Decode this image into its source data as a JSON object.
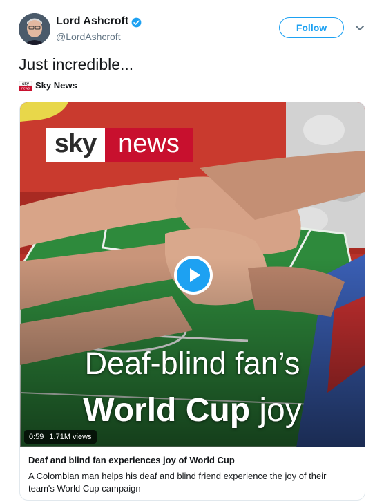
{
  "author": {
    "name": "Lord Ashcroft",
    "handle": "@LordAshcroft"
  },
  "follow_button": {
    "label": "Follow"
  },
  "tweet": {
    "text": "Just incredible..."
  },
  "source": {
    "name": "Sky News"
  },
  "media": {
    "logo": {
      "part1": "sky",
      "part2": "news"
    },
    "headline_line1": "Deaf-blind fan’s",
    "headline_line2_bold": "World Cup",
    "headline_line2_light": "joy",
    "duration": "0:59",
    "views": "1.71M views"
  },
  "card": {
    "title": "Deaf and blind fan experiences joy of World Cup",
    "description": "A Colombian man helps his deaf and blind friend experience the joy of their team's World Cup campaign"
  },
  "colors": {
    "accent": "#1da1f2",
    "sky_red": "#c8102e",
    "pitch_green": "#2e8a3c"
  }
}
